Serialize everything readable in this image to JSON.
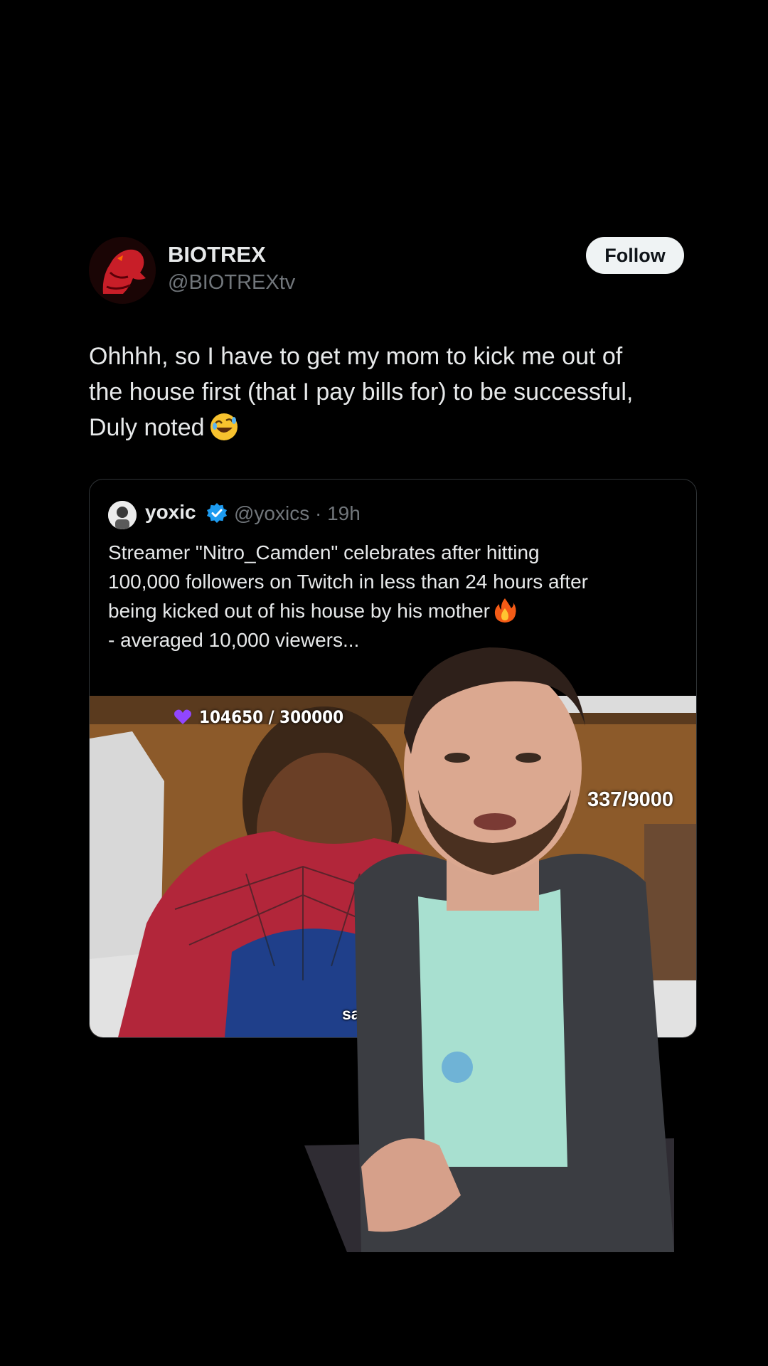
{
  "tweet": {
    "display_name": "BIOTREX",
    "handle": "@BIOTREXtv",
    "follow_label": "Follow",
    "text": "Ohhhh, so I have to get my mom to kick me out of\nthe house first (that I pay bills for) to be successful,\nDuly noted",
    "text_emoji": "rolling-on-floor-laughing-emoji"
  },
  "quote": {
    "name": "yoxic",
    "handle_time": "@yoxics · 19h",
    "verified": true,
    "text": "Streamer \"Nitro_Camden\" celebrates after hitting\n100,000 followers on Twitch in less than 24 hours after\nbeing kicked out of his house by his mother",
    "text_emoji": "fire-emoji",
    "text_continued": "\n- averaged 10,000 viewers...",
    "media": {
      "counter": "104650 / 300000",
      "goal": "337/9000",
      "caption": "say is don"
    }
  },
  "colors": {
    "background": "#000000",
    "text": "#e7e9ea",
    "muted": "#71767b",
    "border": "#2f3336",
    "follow_bg": "#eff3f4",
    "verified": "#1d9bf0"
  }
}
